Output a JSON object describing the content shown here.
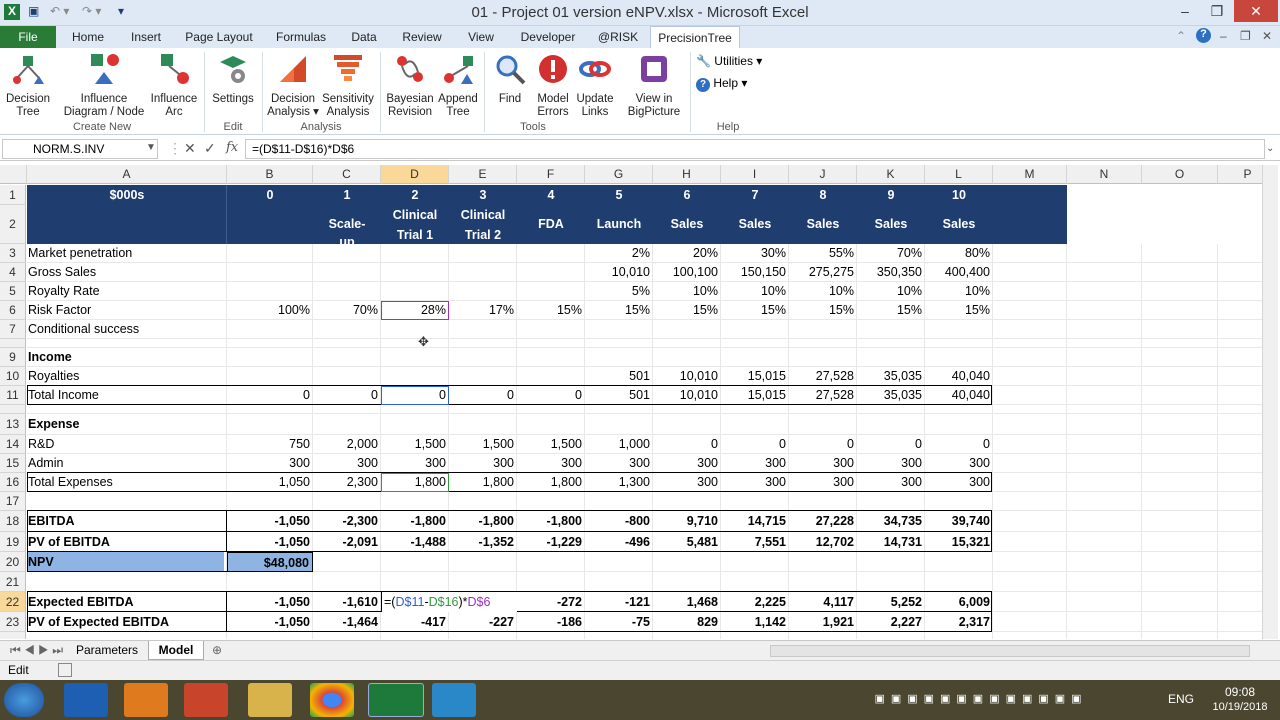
{
  "window": {
    "title": "01 - Project 01 version eNPV.xlsx  -  Microsoft Excel"
  },
  "tabs": [
    "File",
    "Home",
    "Insert",
    "Page Layout",
    "Formulas",
    "Data",
    "Review",
    "View",
    "Developer",
    "@RISK",
    "PrecisionTree"
  ],
  "ribbon": {
    "buttons": [
      {
        "l1": "Decision",
        "l2": "Tree"
      },
      {
        "l1": "Influence",
        "l2": "Diagram / Node"
      },
      {
        "l1": "Influence",
        "l2": "Arc"
      },
      {
        "l1": "Settings",
        "l2": ""
      },
      {
        "l1": "Decision",
        "l2": "Analysis ▾"
      },
      {
        "l1": "Sensitivity",
        "l2": "Analysis"
      },
      {
        "l1": "Bayesian",
        "l2": "Revision"
      },
      {
        "l1": "Append",
        "l2": "Tree"
      },
      {
        "l1": "Find",
        "l2": ""
      },
      {
        "l1": "Model",
        "l2": "Errors"
      },
      {
        "l1": "Update",
        "l2": "Links"
      },
      {
        "l1": "View in",
        "l2": "BigPicture"
      }
    ],
    "small": {
      "utilities": "Utilities ▾",
      "help": "Help ▾"
    },
    "groups": {
      "create": "Create New",
      "edit": "Edit",
      "analysis": "Analysis",
      "tools": "Tools",
      "help": "Help"
    }
  },
  "formula": {
    "namebox": "NORM.S.INV",
    "fx": "fx",
    "text": "=(D$11-D$16)*D$6"
  },
  "columns": [
    "A",
    "B",
    "C",
    "D",
    "E",
    "F",
    "G",
    "H",
    "I",
    "J",
    "K",
    "L",
    "M",
    "N",
    "O",
    "P"
  ],
  "rowNums": [
    "1",
    "2",
    "3",
    "4",
    "5",
    "6",
    "7",
    "8",
    "9",
    "10",
    "11",
    "13",
    "14",
    "15",
    "16",
    "17",
    "18",
    "19",
    "20",
    "21",
    "22",
    "23"
  ],
  "header": {
    "a": "$000s",
    "periods": [
      "0",
      "1",
      "2",
      "3",
      "4",
      "5",
      "6",
      "7",
      "8",
      "9",
      "10"
    ],
    "labels": [
      "",
      "Scale-up",
      "Clinical Trial 1",
      "Clinical Trial 2",
      "FDA",
      "Launch",
      "Sales",
      "Sales",
      "Sales",
      "Sales",
      "Sales"
    ]
  },
  "rows": {
    "r3": {
      "label": "Market penetration",
      "vals": [
        "",
        "",
        "",
        "",
        "",
        "2%",
        "20%",
        "30%",
        "55%",
        "70%",
        "80%"
      ]
    },
    "r4": {
      "label": "Gross Sales",
      "vals": [
        "",
        "",
        "",
        "",
        "",
        "10,010",
        "100,100",
        "150,150",
        "275,275",
        "350,350",
        "400,400"
      ]
    },
    "r5": {
      "label": "Royalty Rate",
      "vals": [
        "",
        "",
        "",
        "",
        "",
        "5%",
        "10%",
        "10%",
        "10%",
        "10%",
        "10%"
      ]
    },
    "r6": {
      "label": "Risk Factor",
      "vals": [
        "100%",
        "70%",
        "28%",
        "17%",
        "15%",
        "15%",
        "15%",
        "15%",
        "15%",
        "15%",
        "15%"
      ]
    },
    "r7": {
      "label": "Conditional success"
    },
    "r9": {
      "label": "Income"
    },
    "r10": {
      "label": "Royalties",
      "vals": [
        "",
        "",
        "",
        "",
        "",
        "501",
        "10,010",
        "15,015",
        "27,528",
        "35,035",
        "40,040"
      ]
    },
    "r11": {
      "label": "Total Income",
      "vals": [
        "0",
        "0",
        "0",
        "0",
        "0",
        "501",
        "10,010",
        "15,015",
        "27,528",
        "35,035",
        "40,040"
      ]
    },
    "r13": {
      "label": "Expense"
    },
    "r14": {
      "label": "R&D",
      "vals": [
        "750",
        "2,000",
        "1,500",
        "1,500",
        "1,500",
        "1,000",
        "0",
        "0",
        "0",
        "0",
        "0"
      ]
    },
    "r15": {
      "label": "Admin",
      "vals": [
        "300",
        "300",
        "300",
        "300",
        "300",
        "300",
        "300",
        "300",
        "300",
        "300",
        "300"
      ]
    },
    "r16": {
      "label": "Total Expenses",
      "vals": [
        "1,050",
        "2,300",
        "1,800",
        "1,800",
        "1,800",
        "1,300",
        "300",
        "300",
        "300",
        "300",
        "300"
      ]
    },
    "r18": {
      "label": "EBITDA",
      "vals": [
        "-1,050",
        "-2,300",
        "-1,800",
        "-1,800",
        "-1,800",
        "-800",
        "9,710",
        "14,715",
        "27,228",
        "34,735",
        "39,740"
      ]
    },
    "r19": {
      "label": "PV of EBITDA",
      "vals": [
        "-1,050",
        "-2,091",
        "-1,488",
        "-1,352",
        "-1,229",
        "-496",
        "5,481",
        "7,551",
        "12,702",
        "14,731",
        "15,321"
      ]
    },
    "r20": {
      "label": "NPV",
      "val": "$48,080"
    },
    "r22": {
      "label": "Expected EBITDA",
      "vals": [
        "-1,050",
        "-1,610",
        "",
        "",
        "-272",
        "-121",
        "1,468",
        "2,225",
        "4,117",
        "5,252",
        "6,009"
      ]
    },
    "r23": {
      "label": "PV of Expected EBITDA",
      "vals": [
        "-1,050",
        "-1,464",
        "-417",
        "-227",
        "-186",
        "-75",
        "829",
        "1,142",
        "1,921",
        "2,227",
        "2,317"
      ]
    }
  },
  "editing": {
    "p1": "=(",
    "p2": "D$11",
    "p3": "-",
    "p4": "D$16",
    "p5": ")*",
    "p6": "D$6"
  },
  "sheets": [
    "Parameters",
    "Model"
  ],
  "status": "Edit",
  "tray": {
    "lang": "ENG",
    "time": "09:08",
    "date": "10/19/2018"
  },
  "colors": {
    "header": "#1f3d6f",
    "npv": "#8db4e2",
    "file": "#2a7b36"
  }
}
